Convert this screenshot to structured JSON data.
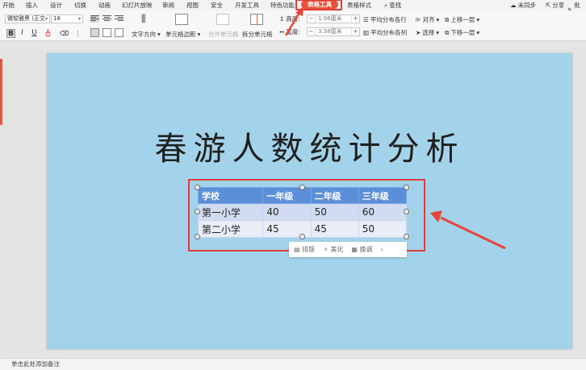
{
  "menu": {
    "tabs": [
      "开始",
      "插入",
      "设计",
      "切换",
      "动画",
      "幻灯片放映",
      "审阅",
      "视图",
      "安全",
      "开发工具",
      "特色功能",
      "表格工具",
      "表格样式"
    ],
    "active_tab": "表格工具",
    "search": "查找",
    "sync": "未同步",
    "share": "分享",
    "comment": "批注"
  },
  "ribbon": {
    "font_name": "微软雅黑 (正文",
    "font_size": "18",
    "text_direction": "文字方向",
    "cell_margin": "单元格边距",
    "merge_cells": "合并单元格",
    "split_cells": "拆分单元格",
    "height_label": "高度:",
    "height_value": "1.06厘米",
    "width_label": "宽度:",
    "width_value": "3.38厘米",
    "distribute_rows": "平均分布各行",
    "distribute_cols": "平均分布各列",
    "align": "对齐",
    "select": "选择",
    "bring_forward": "上移一层",
    "send_backward": "下移一层",
    "bold": "B",
    "italic": "I",
    "underline": "U",
    "font_color": "A"
  },
  "slide": {
    "title": "春游人数统计分析",
    "table": {
      "headers": [
        "学校",
        "一年级",
        "二年级",
        "三年级"
      ],
      "rows": [
        [
          "第一小学",
          "40",
          "50",
          "60"
        ],
        [
          "第二小学",
          "45",
          "45",
          "50"
        ]
      ]
    },
    "float_toolbar": {
      "sort": "排版",
      "beautify": "美化",
      "recolor": "换调"
    }
  },
  "status": {
    "notes": "单击此处添加备注"
  },
  "colors": {
    "slide_bg": "#a3d3ea",
    "table_header": "#5b8fd9",
    "accent": "#e8543b",
    "highlight": "#e03c3c"
  }
}
